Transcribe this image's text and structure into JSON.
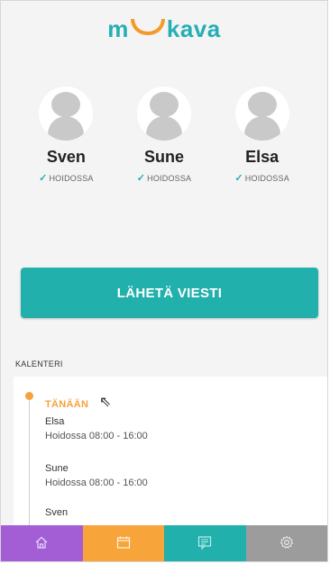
{
  "app": {
    "logo": "mukava",
    "logo_left": "m",
    "logo_right": "kava"
  },
  "children": [
    {
      "name": "Sven",
      "status": "HOIDOSSA"
    },
    {
      "name": "Sune",
      "status": "HOIDOSSA"
    },
    {
      "name": "Elsa",
      "status": "HOIDOSSA"
    }
  ],
  "send_button": {
    "label": "LÄHETÄ VIESTI"
  },
  "calendar": {
    "label": "KALENTERI",
    "today": "TÄNÄÄN",
    "entries": [
      {
        "name": "Elsa",
        "detail": "Hoidossa  08:00 - 16:00"
      },
      {
        "name": "Sune",
        "detail": "Hoidossa  08:00 - 16:00"
      },
      {
        "name": "Sven",
        "detail": ""
      }
    ]
  },
  "tabbar": {
    "tabs": [
      {
        "name": "home",
        "icon": "home-icon",
        "color": "#a35ed6"
      },
      {
        "name": "calendar",
        "icon": "calendar-icon",
        "color": "#f7a43b"
      },
      {
        "name": "messages",
        "icon": "message-icon",
        "color": "#21b0ab"
      },
      {
        "name": "settings",
        "icon": "gear-icon",
        "color": "#9c9c9c"
      }
    ]
  }
}
